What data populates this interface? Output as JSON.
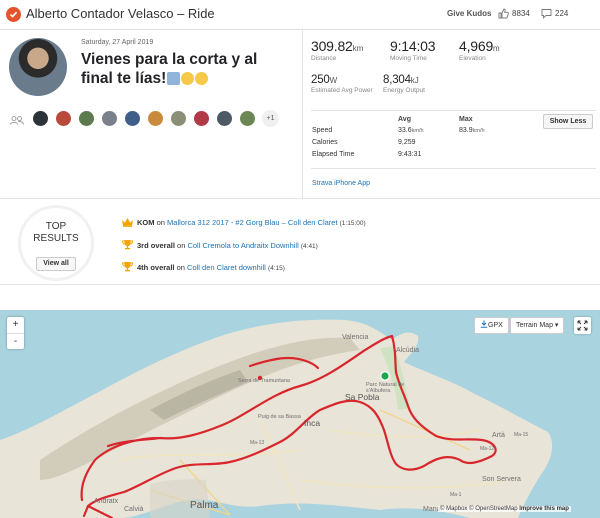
{
  "header": {
    "athlete_name": "Alberto Contador Velasco",
    "separator": "–",
    "activity_type": "Ride",
    "give_kudos_label": "Give Kudos",
    "kudos_count": "8834",
    "comments_count": "224",
    "brand_color": "#e5532d"
  },
  "activity": {
    "date": "Saturday, 27 April 2019",
    "title": "Vienes para la corta y al final te lías!",
    "more_athletes_label": "+1"
  },
  "stats": {
    "distance": {
      "value": "309.82",
      "unit": "km",
      "label": "Distance"
    },
    "moving_time": {
      "value": "9:14:03",
      "label": "Moving Time"
    },
    "elevation": {
      "value": "4,969",
      "unit": "m",
      "label": "Elevation"
    },
    "avg_power": {
      "value": "250",
      "unit": "W",
      "label": "Estimated Avg Power"
    },
    "energy": {
      "value": "8,304",
      "unit": "kJ",
      "label": "Energy Output"
    }
  },
  "details": {
    "col_avg": "Avg",
    "col_max": "Max",
    "show_less_label": "Show Less",
    "rows": [
      {
        "label": "Speed",
        "avg": "33.6",
        "avg_unit": "km/h",
        "max": "83.9",
        "max_unit": "km/h"
      },
      {
        "label": "Calories",
        "avg": "9,259",
        "avg_unit": "",
        "max": "",
        "max_unit": ""
      },
      {
        "label": "Elapsed Time",
        "avg": "9:43:31",
        "avg_unit": "",
        "max": "",
        "max_unit": ""
      }
    ],
    "device": "Strava iPhone App"
  },
  "top_results": {
    "title_line1": "TOP",
    "title_line2": "RESULTS",
    "view_all_label": "View all",
    "items": [
      {
        "rank": "KOM",
        "on": "on",
        "segment": "Mallorca 312 2017 - #2 Gorg Blau – Coll den Claret",
        "time": "(1:15:00)",
        "icon": "crown-icon"
      },
      {
        "rank": "3rd overall",
        "on": "on",
        "segment": "Coll Cremola to Andraitx Downhill",
        "time": "(4:41)",
        "icon": "trophy-icon"
      },
      {
        "rank": "4th overall",
        "on": "on",
        "segment": "Coll den Claret downhill",
        "time": "(4:15)",
        "icon": "trophy-icon"
      }
    ]
  },
  "map": {
    "zoom_in": "+",
    "zoom_out": "-",
    "gpx_label": "GPX",
    "map_type_label": "Terrain Map",
    "map_type_caret": "▾",
    "attribution_mapbox": "© Mapbox",
    "attribution_osm": "© OpenStreetMap",
    "attribution_improve": "Improve this map",
    "route_color": "#d8262c",
    "labels": {
      "valencia": "Valencia",
      "alcudia": "Alcúdia",
      "parc": "Parc Natural de s'Albufera",
      "sa_pobla": "Sa Pobla",
      "inca": "Inca",
      "puig": "Puig de sa Bassa",
      "serra": "Serra de Tramuntana",
      "arta": "Artà",
      "son_servera": "Son Servera",
      "palma": "Palma",
      "calvia": "Calvià",
      "andratx": "Andratx",
      "manacor": "Mana",
      "ma15": "Ma-15",
      "ma13": "Ma-13",
      "ma12": "Ma-12",
      "ma1": "Ma-1"
    }
  }
}
